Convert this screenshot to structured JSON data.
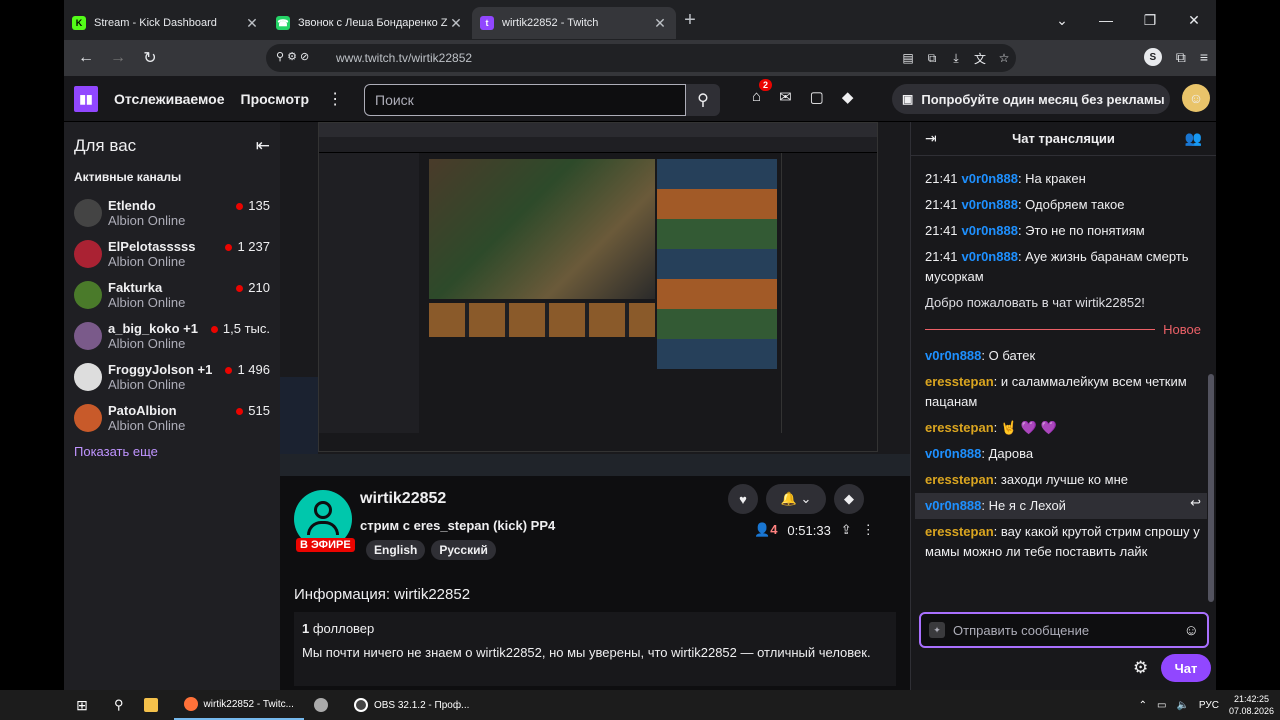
{
  "browser": {
    "tabs": [
      {
        "title": "Stream - Kick Dashboard",
        "fav": "K",
        "fav_color": "#53fc18"
      },
      {
        "title": "Звонок с Леша Бондаренко ZET",
        "fav": "☎",
        "fav_color": "#25d366"
      },
      {
        "title": "wirtik22852 - Twitch",
        "fav": "t",
        "fav_color": "#9147ff"
      }
    ],
    "url": "www.twitch.tv/wirtik22852"
  },
  "nav": {
    "following": "Отслеживаемое",
    "browse": "Просмотр",
    "search_placeholder": "Поиск",
    "notif_count": "2",
    "promo": "Попробуйте один месяц без рекламы"
  },
  "sidebar": {
    "for_you": "Для вас",
    "active_channels": "Активные каналы",
    "channels": [
      {
        "name": "Etlendo",
        "game": "Albion Online",
        "viewers": "135",
        "color": "#444"
      },
      {
        "name": "ElPelotasssss",
        "game": "Albion Online",
        "viewers": "1 237",
        "color": "#a23"
      },
      {
        "name": "Fakturka",
        "game": "Albion Online",
        "viewers": "210",
        "color": "#4a7a2a"
      },
      {
        "name": "a_big_koko +1",
        "game": "Albion Online",
        "viewers": "1,5 тыс.",
        "color": "#7a5a8a"
      },
      {
        "name": "FroggyJolson +1",
        "game": "Albion Online",
        "viewers": "1 496",
        "color": "#ddd"
      },
      {
        "name": "PatoAlbion",
        "game": "Albion Online",
        "viewers": "515",
        "color": "#c85a2a"
      }
    ],
    "show_more": "Показать еще"
  },
  "channel": {
    "name": "wirtik22852",
    "live": "В ЭФИРЕ",
    "title": "стрим с eres_stepan (kick) PP4",
    "tags": [
      "English",
      "Русский"
    ],
    "viewers": "4",
    "uptime": "0:51:33",
    "info_heading": "Информация: wirtik22852",
    "followers_count": "1",
    "followers_label": "фолловер",
    "about": "Мы почти ничего не знаем о wirtik22852, но мы уверены, что wirtik22852 — отличный человек."
  },
  "chat": {
    "header": "Чат трансляции",
    "messages_top": [
      {
        "time": "21:41",
        "user": "v0r0n888",
        "text": "На кракен"
      },
      {
        "time": "21:41",
        "user": "v0r0n888",
        "text": "Одобряем такое"
      },
      {
        "time": "21:41",
        "user": "v0r0n888",
        "text": "Это не по понятиям"
      },
      {
        "time": "21:41",
        "user": "v0r0n888",
        "text": "Ауе жизнь баранам смерть мусоркам"
      }
    ],
    "welcome": "Добро пожаловать в чат wirtik22852!",
    "new_label": "Новое",
    "messages_new": [
      {
        "user": "v0r0n888",
        "text": "О батек",
        "color": "blue"
      },
      {
        "user": "eresstepan",
        "text": "и саламмалейкум всем четким пацанам",
        "color": "gold"
      },
      {
        "user": "eresstepan",
        "text": "🤘 💜 💜",
        "color": "gold"
      },
      {
        "user": "v0r0n888",
        "text": "Дарова",
        "color": "blue"
      },
      {
        "user": "eresstepan",
        "text": "заходи лучше ко мне",
        "color": "gold"
      },
      {
        "user": "v0r0n888",
        "text": "Не я с Лехой",
        "color": "blue"
      },
      {
        "user": "eresstepan",
        "text": "вау какой крутой стрим спрошу у мамы можно ли тебе поставить лайк",
        "color": "gold"
      }
    ],
    "input_placeholder": "Отправить сообщение",
    "send_label": "Чат"
  },
  "taskbar": {
    "apps": [
      {
        "label": "wirtik22852 - Twitc...",
        "color": "#ff7139"
      },
      {
        "label": "",
        "color": "#aaa"
      },
      {
        "label": "OBS 32.1.2 - Проф...",
        "color": "#444"
      }
    ],
    "lang": "РУС",
    "time": "21:42:25",
    "date": "07.08.2026"
  }
}
